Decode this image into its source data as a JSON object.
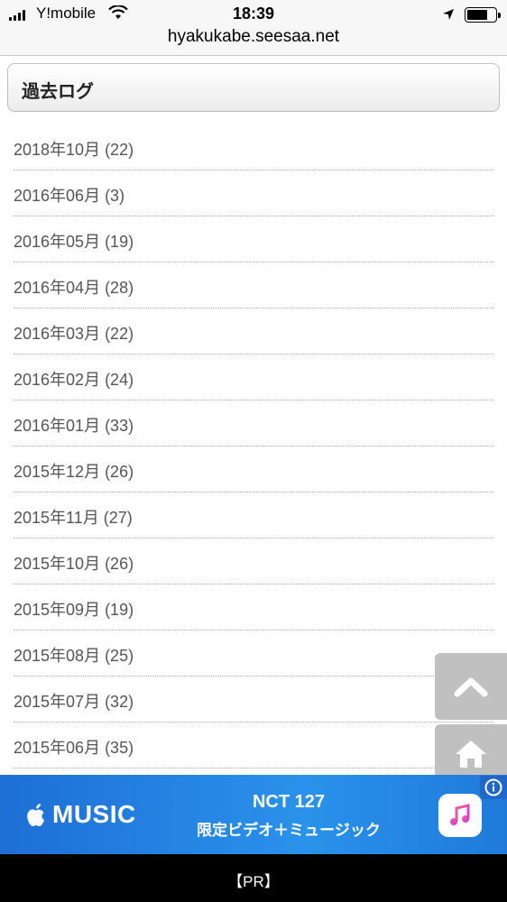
{
  "status_bar": {
    "carrier": "Y!mobile",
    "time": "18:39",
    "url": "hyakukabe.seesaa.net"
  },
  "archive": {
    "title": "過去ログ",
    "items": [
      {
        "label": "2018年10月 (22)"
      },
      {
        "label": "2016年06月 (3)"
      },
      {
        "label": "2016年05月 (19)"
      },
      {
        "label": "2016年04月 (28)"
      },
      {
        "label": "2016年03月 (22)"
      },
      {
        "label": "2016年02月 (24)"
      },
      {
        "label": "2016年01月 (33)"
      },
      {
        "label": "2015年12月 (26)"
      },
      {
        "label": "2015年11月 (27)"
      },
      {
        "label": "2015年10月 (26)"
      },
      {
        "label": "2015年09月 (19)"
      },
      {
        "label": "2015年08月 (25)"
      },
      {
        "label": "2015年07月 (32)"
      },
      {
        "label": "2015年06月 (35)"
      }
    ]
  },
  "floating_buttons": {
    "top_icon": "chevron-up-icon",
    "home_icon": "home-icon"
  },
  "ad": {
    "brand": "MUSIC",
    "title": "NCT 127",
    "subtitle": "限定ビデオ＋ミュージック",
    "color": "#2a86e0"
  },
  "pr_label": "【PR】"
}
